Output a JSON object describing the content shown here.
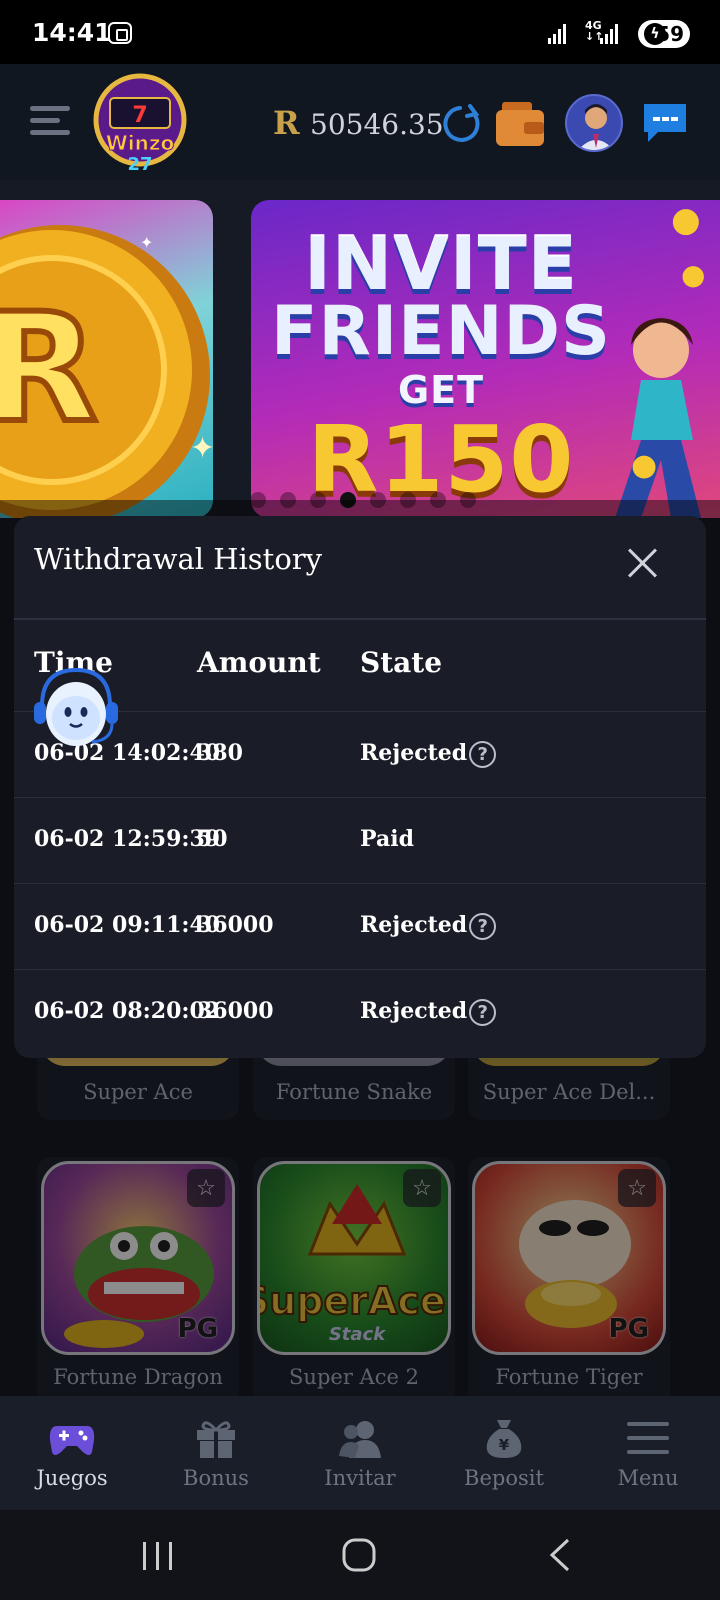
{
  "status_bar": {
    "time": "14:41",
    "network": "4G",
    "battery": "59"
  },
  "header": {
    "currency_symbol": "R",
    "balance": "50546.35"
  },
  "banners": [
    {
      "lines": [
        "INVITE",
        "FRIENDS",
        "GET",
        "R150"
      ]
    }
  ],
  "modal": {
    "title": "Withdrawal History",
    "columns": [
      "Time",
      "Amount",
      "State"
    ],
    "rows": [
      {
        "time": "06-02 14:02:40",
        "amount": "380",
        "state": "Rejected",
        "help": true
      },
      {
        "time": "06-02 12:59:39",
        "amount": "50",
        "state": "Paid",
        "help": false
      },
      {
        "time": "06-02 09:11:40",
        "amount": "36000",
        "state": "Rejected",
        "help": true
      },
      {
        "time": "06-02 08:20:02",
        "amount": "36000",
        "state": "Rejected",
        "help": true
      }
    ],
    "help_glyph": "?"
  },
  "games": [
    {
      "name": "Super Ace"
    },
    {
      "name": "Fortune Snake"
    },
    {
      "name": "Super Ace Del..."
    },
    {
      "name": "Fortune Dragon",
      "badge": "PG"
    },
    {
      "name": "Super Ace 2"
    },
    {
      "name": "Fortune Tiger",
      "badge": "PG"
    }
  ],
  "tabbar": {
    "items": [
      {
        "label": "Juegos",
        "icon": "gamepad-icon",
        "active": true
      },
      {
        "label": "Bonus",
        "icon": "gift-icon",
        "active": false
      },
      {
        "label": "Invitar",
        "icon": "users-icon",
        "active": false
      },
      {
        "label": "Beposit",
        "icon": "money-bag-icon",
        "active": false
      },
      {
        "label": "Menu",
        "icon": "menu-icon",
        "active": false
      }
    ]
  },
  "colors": {
    "accent_gold": "#c9a14a",
    "modal_bg": "#1a1d27",
    "page_bg": "#161a24",
    "active_tab_icon": "#6b4fd8"
  }
}
